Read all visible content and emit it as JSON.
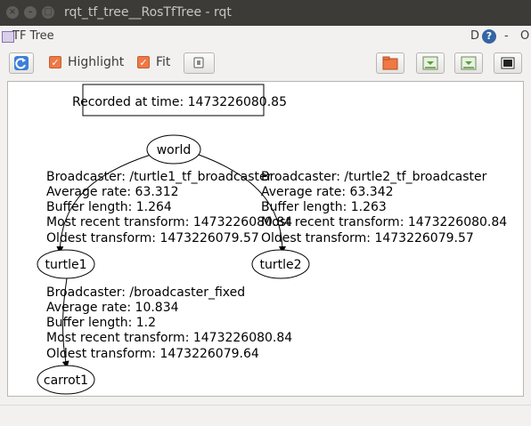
{
  "window": {
    "title": "rqt_tf_tree__RosTfTree - rqt",
    "close_glyph": "×",
    "minimize_glyph": "–",
    "maximize_glyph": "□"
  },
  "plugin": {
    "title": "TF Tree",
    "help_d": "D",
    "help_q": "?",
    "dash": "-",
    "close": "O"
  },
  "toolbar": {
    "highlight_label": "Highlight",
    "fit_label": "Fit",
    "highlight_checked": true,
    "fit_checked": true
  },
  "graph": {
    "recorded_label": "Recorded at time: 1473226080.85",
    "nodes": {
      "world": "world",
      "turtle1": "turtle1",
      "turtle2": "turtle2",
      "carrot1": "carrot1"
    },
    "edges": {
      "world_turtle1": [
        "Broadcaster: /turtle1_tf_broadcaster",
        "Average rate: 63.312",
        "Buffer length: 1.264",
        "Most recent transform: 1473226080.84",
        "Oldest transform: 1473226079.57"
      ],
      "world_turtle2": [
        "Broadcaster: /turtle2_tf_broadcaster",
        "Average rate: 63.342",
        "Buffer length: 1.263",
        "Most recent transform: 1473226080.84",
        "Oldest transform: 1473226079.57"
      ],
      "turtle1_carrot1": [
        "Broadcaster: /broadcaster_fixed",
        "Average rate: 10.834",
        "Buffer length: 1.2",
        "Most recent transform: 1473226080.84",
        "Oldest transform: 1473226079.64"
      ]
    }
  }
}
